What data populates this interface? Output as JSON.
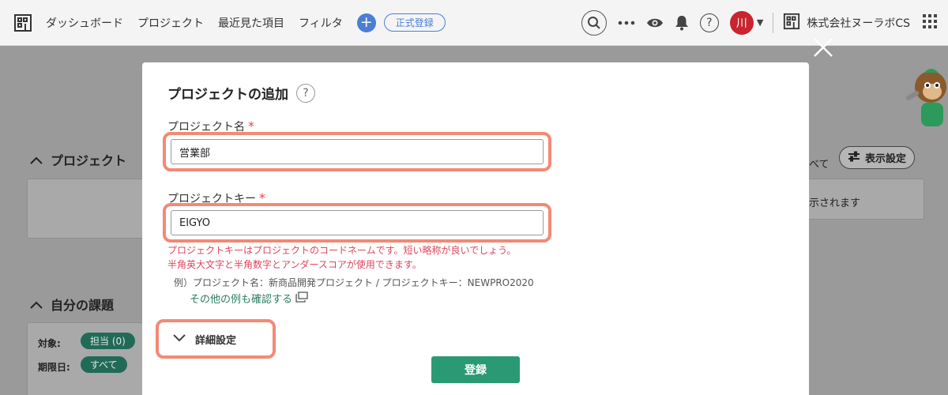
{
  "header": {
    "nav": [
      "ダッシュボード",
      "プロジェクト",
      "最近見た項目",
      "フィルタ"
    ],
    "register_label": "正式登録",
    "avatar_initial": "川",
    "org_name": "株式会社ヌーラボCS"
  },
  "background": {
    "projects_title": "プロジェクト",
    "show_all_fragment": "べて",
    "display_settings_label": "表示設定",
    "projects_empty_fragment": "示されます",
    "my_issues_title": "自分の課題",
    "target_label": "対象:",
    "target_pill": "担当 (0)",
    "due_label": "期限日:",
    "due_pill": "すべて"
  },
  "modal": {
    "title": "プロジェクトの追加",
    "help_glyph": "?",
    "project_name_label": "プロジェクト名",
    "required_mark": "*",
    "project_name_value": "営業部",
    "project_key_label": "プロジェクトキー",
    "project_key_value": "EIGYO",
    "key_error_line1": "プロジェクトキーはプロジェクトのコードネームです。短い略称が良いでしょう。",
    "key_error_line2": "半角英大文字と半角数字とアンダースコアが使用できます。",
    "example_text": "例）プロジェクト名：新商品開発プロジェクト / プロジェクトキー：NEWPRO2020",
    "example_link": "その他の例も確認する",
    "advanced_label": "詳細設定",
    "submit_label": "登録"
  },
  "colors": {
    "accent_blue": "#4a7fd4",
    "highlight_orange": "#f28a75",
    "error_red": "#e0445c",
    "link_green": "#2a7d5f",
    "submit_green": "#2a9a75",
    "avatar_red": "#c9242f"
  },
  "icons": [
    "building-icon",
    "plus-icon",
    "search-icon",
    "more-icon",
    "eye-icon",
    "bell-icon",
    "help-icon",
    "chevron-up-icon",
    "settings-icon",
    "chevron-down-icon",
    "external-link-icon",
    "close-icon",
    "grid-icon",
    "mascot-icon"
  ]
}
